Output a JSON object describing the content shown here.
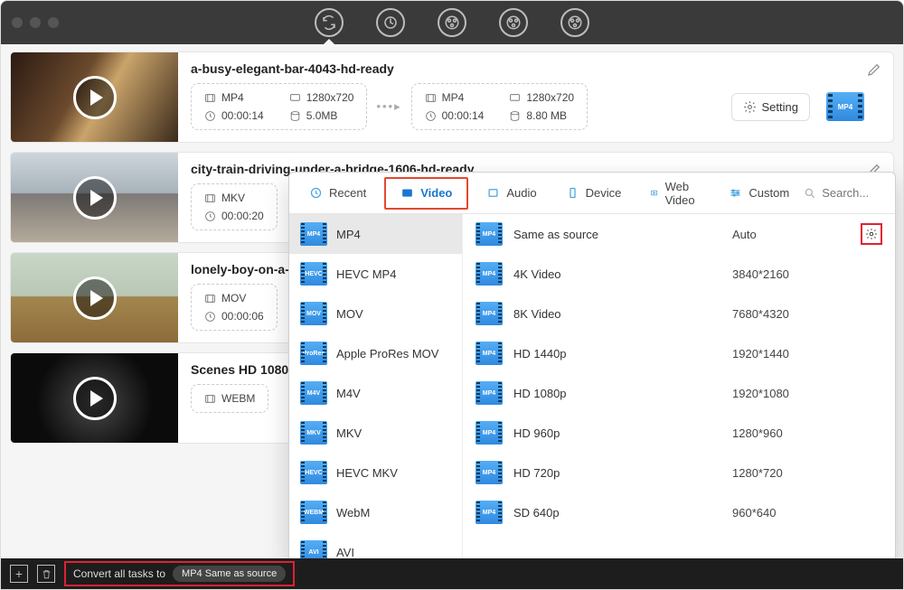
{
  "titlebar": {
    "icons": [
      "sync",
      "refresh",
      "film",
      "film-plus",
      "film-x"
    ]
  },
  "tasks": [
    {
      "title": "a-busy-elegant-bar-4043-hd-ready",
      "thumb": "bar",
      "src": {
        "format": "MP4",
        "duration": "00:00:14",
        "resolution": "1280x720",
        "size": "5.0MB"
      },
      "dst": {
        "format": "MP4",
        "duration": "00:00:14",
        "resolution": "1280x720",
        "size": "8.80 MB"
      },
      "badge": "MP4",
      "setting_label": "Setting"
    },
    {
      "title": "city-train-driving-under-a-bridge-1606-hd-ready",
      "thumb": "train",
      "src": {
        "format": "MKV",
        "duration": "00:00:20"
      }
    },
    {
      "title": "lonely-boy-on-a-",
      "thumb": "bench",
      "src": {
        "format": "MOV",
        "duration": "00:00:06"
      }
    },
    {
      "title": "Scenes HD 1080",
      "thumb": "dark",
      "src": {
        "format": "WEBM"
      }
    }
  ],
  "popup": {
    "tabs": [
      "Recent",
      "Video",
      "Audio",
      "Device",
      "Web Video",
      "Custom"
    ],
    "active_tab": "Video",
    "search_placeholder": "Search...",
    "formats": [
      "MP4",
      "HEVC MP4",
      "MOV",
      "Apple ProRes MOV",
      "M4V",
      "MKV",
      "HEVC MKV",
      "WebM",
      "AVI"
    ],
    "format_icon_labels": [
      "MP4",
      "HEVC MP4",
      "MOV",
      "ProRes MOV",
      "M4V",
      "MKV",
      "HEVC MKV",
      "WEBM",
      "AVI"
    ],
    "selected_format": "MP4",
    "presets": [
      {
        "name": "Same as source",
        "res": "Auto",
        "gear": true
      },
      {
        "name": "4K Video",
        "res": "3840*2160"
      },
      {
        "name": "8K Video",
        "res": "7680*4320"
      },
      {
        "name": "HD 1440p",
        "res": "1920*1440"
      },
      {
        "name": "HD 1080p",
        "res": "1920*1080"
      },
      {
        "name": "HD 960p",
        "res": "1280*960"
      },
      {
        "name": "HD 720p",
        "res": "1280*720"
      },
      {
        "name": "SD 640p",
        "res": "960*640"
      }
    ]
  },
  "bottom": {
    "label": "Convert all tasks to",
    "value": "MP4 Same as source"
  }
}
